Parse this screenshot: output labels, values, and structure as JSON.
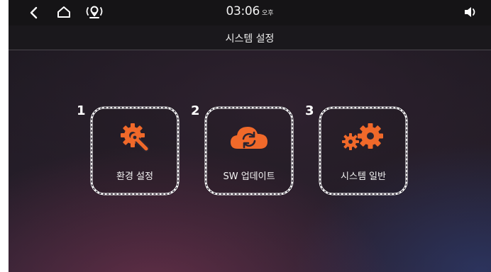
{
  "status_bar": {
    "time": "03:06",
    "ampm": "오후",
    "icons": [
      "back-arrow-icon",
      "home-icon",
      "gps-location-icon",
      "volume-icon"
    ]
  },
  "title": "시스템 설정",
  "tiles": [
    {
      "number": "1",
      "label": "환경 설정",
      "icon": "settings-wrench-icon"
    },
    {
      "number": "2",
      "label": "SW 업데이트",
      "icon": "cloud-sync-icon"
    },
    {
      "number": "3",
      "label": "시스템 일반",
      "icon": "gears-icon"
    }
  ],
  "colors": {
    "accent": "#f0692a",
    "status_bar": "#151416",
    "text": "#f2f2f2"
  }
}
